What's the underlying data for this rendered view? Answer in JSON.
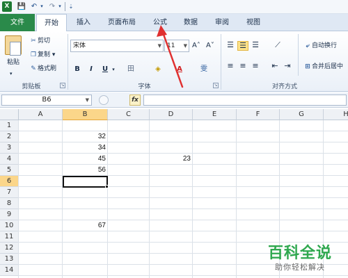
{
  "qat": {
    "app_icon": "X",
    "save_icon": "💾",
    "undo_icon": "↶",
    "redo_icon": "↷",
    "dd": "▾",
    "more": "⇣"
  },
  "tabs": [
    {
      "label": "文件"
    },
    {
      "label": "开始"
    },
    {
      "label": "插入"
    },
    {
      "label": "页面布局"
    },
    {
      "label": "公式"
    },
    {
      "label": "数据"
    },
    {
      "label": "审阅"
    },
    {
      "label": "视图"
    }
  ],
  "clipboard": {
    "paste": "粘贴",
    "paste_dd": "▾",
    "cut": "剪切",
    "copy": "复制",
    "copy_dd": "▾",
    "painter": "格式刷",
    "group": "剪贴板"
  },
  "font": {
    "name": "宋体",
    "size": "11",
    "grow": "A˄",
    "shrink": "A˅",
    "bold": "B",
    "italic": "I",
    "underline": "U",
    "underline_dd": "▾",
    "border": "田",
    "fill": "◈",
    "fontcolor": "A",
    "phonetic": "雯",
    "group": "字体"
  },
  "alignment": {
    "wrap": "自动换行",
    "merge": "合并后居中",
    "group": "对齐方式"
  },
  "formula_bar": {
    "name_box": "B6",
    "fx": "fx"
  },
  "grid": {
    "columns": [
      "A",
      "B",
      "C",
      "D",
      "E",
      "F",
      "G",
      "H"
    ],
    "rows": [
      "1",
      "2",
      "3",
      "4",
      "5",
      "6",
      "7",
      "8",
      "9",
      "10",
      "11",
      "12",
      "13",
      "14"
    ],
    "selected_column": "B",
    "selected_row": "6",
    "cells": {
      "B2": "32",
      "B3": "34",
      "B4": "45",
      "B5": "56",
      "B10": "67",
      "D4": "23"
    }
  },
  "watermark": {
    "title": "百科全说",
    "subtitle": "助你轻松解决"
  },
  "colors": {
    "file_tab": "#2a8a4a",
    "selection": "#fbd68a",
    "arrow": "#e03030",
    "watermark": "#2fa84f"
  }
}
